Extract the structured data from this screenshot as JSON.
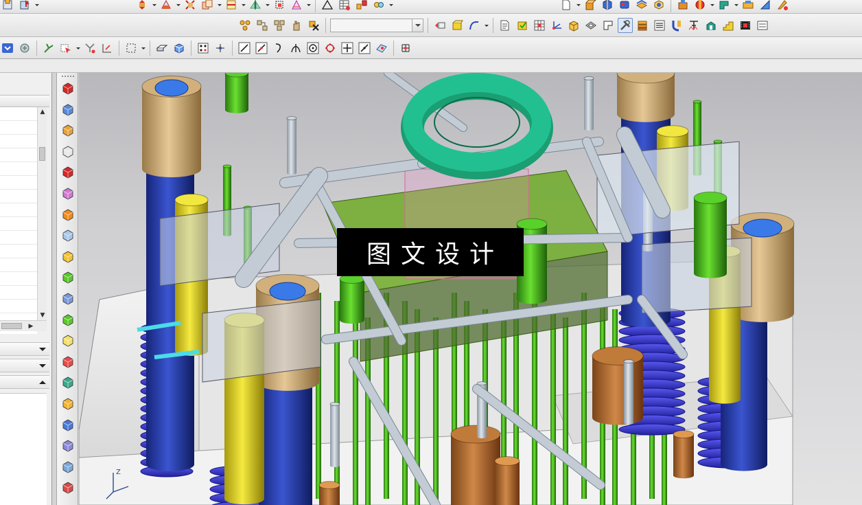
{
  "toolbar_row1": {
    "icons": [
      "assembly-icon",
      "move-icon",
      "sketch-icon",
      "trim-icon",
      "copy-icon",
      "constraint-icon",
      "mirror-icon",
      "scale-icon",
      "measure-icon",
      "triangle-icon",
      "table-icon",
      "explode-icon",
      "link-icon",
      "new-file-icon",
      "cube-stack-icon",
      "solid-icon",
      "surface-icon",
      "sheet-metal-icon",
      "mold-icon",
      "render-icon"
    ]
  },
  "toolbar_row2": {
    "icons": [
      "feature-group-icon",
      "feature-connect-icon",
      "feature-pattern-icon",
      "hand-icon",
      "delete-feature-icon",
      "view-cube-icon",
      "render-mode-icon",
      "curve-icon",
      "detail-icon",
      "layer-icon",
      "grid-icon",
      "csys-icon",
      "box-icon",
      "shell-icon",
      "split-icon",
      "tool-icon",
      "stack-icon",
      "list-icon",
      "bend-icon",
      "text-icon",
      "paint-icon",
      "stairs-icon",
      "film-icon",
      "more-icon"
    ],
    "combo_value": ""
  },
  "toolbar_row3": {
    "icons": [
      "dropdown-arrow-icon",
      "refresh-icon",
      "snap-icon",
      "select-icon",
      "filter-icon",
      "section-icon",
      "box-select-icon",
      "shaded-icon",
      "cube-icon",
      "point-icon",
      "star-point-icon",
      "line-icon",
      "line-end-icon",
      "arc-icon",
      "intersect-icon",
      "circle-center-icon",
      "circle-quadrant-icon",
      "plus-point-icon",
      "slash-icon",
      "face-icon",
      "grid-dot-icon"
    ]
  },
  "resource_bar": {
    "icons": [
      "red-cube-icon",
      "assembly-nav-icon",
      "constraint-nav-icon",
      "part-nav-icon",
      "red-solid-icon",
      "pink-surface-icon",
      "orange-shape-icon",
      "plane-icon",
      "layers-icon",
      "green-curve-icon",
      "mold-wizard-icon",
      "check-icon",
      "box-outline-icon",
      "red-block-icon",
      "base-icon",
      "orange-tray-icon",
      "blue-cubes-icon",
      "gear-cubes-icon",
      "analysis-icon",
      "palette-icon"
    ]
  },
  "navigator": {
    "rows": 16
  },
  "watermark": {
    "text": "图文设计"
  },
  "colors": {
    "blue_post": "#2a3fa8",
    "yellow_pin": "#e6d81a",
    "green_pin": "#4cb81e",
    "spring": "#3a3ad6",
    "tan_bush": "#d2b07c",
    "teal_ring": "#1a9e72",
    "plate": "#ececec",
    "grey_bar": "#b9c2cc"
  }
}
